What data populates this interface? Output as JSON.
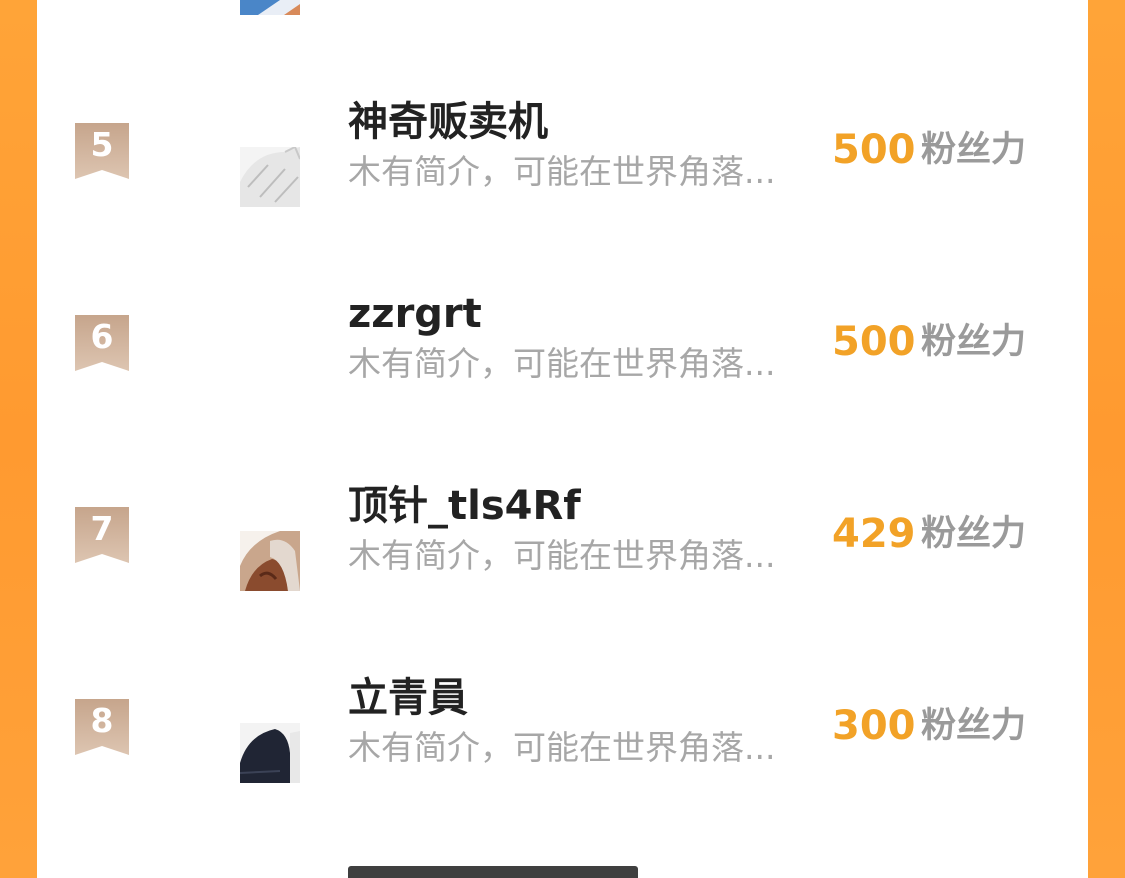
{
  "colors": {
    "background": "#ff9a30",
    "score": "#f2a227",
    "rank_badge": "#c9ab92",
    "name": "#222222",
    "bio": "#a7a7a7",
    "unit": "#9a9a9a"
  },
  "ranking": {
    "unit_label": "粉丝力",
    "items": [
      {
        "rank": "5",
        "name": "神奇贩卖机",
        "bio": "木有简介，可能在世界角落...",
        "score": "500",
        "avatar": "sketch-avatar"
      },
      {
        "rank": "6",
        "name": "zzrgrt",
        "bio": "木有简介，可能在世界角落...",
        "score": "500",
        "avatar": "blank-avatar"
      },
      {
        "rank": "7",
        "name": "顶针_tls4Rf",
        "bio": "木有简介，可能在世界角落...",
        "score": "429",
        "avatar": "photo-avatar"
      },
      {
        "rank": "8",
        "name": "立青員",
        "bio": "木有简介，可能在世界角落...",
        "score": "300",
        "avatar": "dark-avatar"
      }
    ]
  }
}
